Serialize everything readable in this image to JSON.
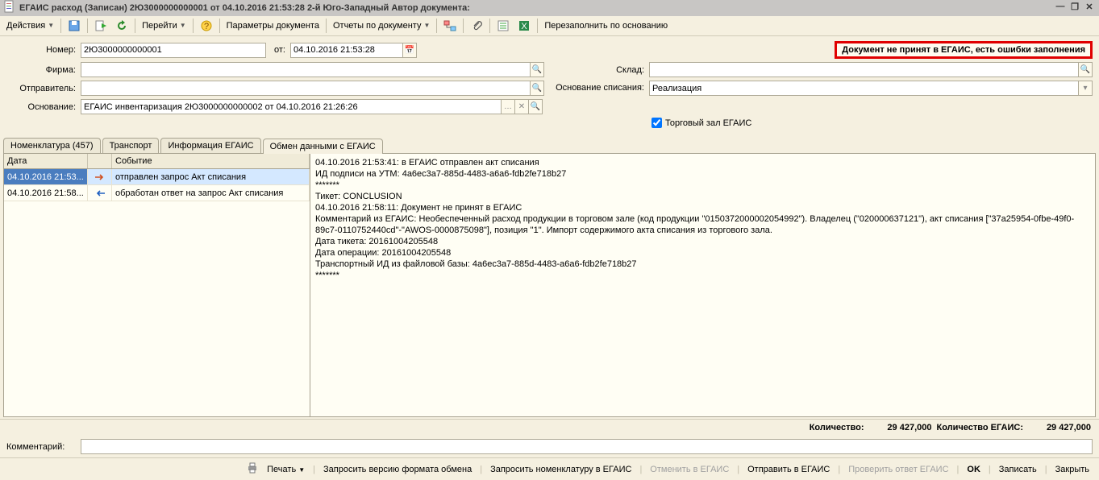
{
  "title": "ЕГАИС расход (Записан)  2Ю3000000000001 от 04.10.2016 21:53:28 2-й Юго-Западный Автор документа:",
  "toolbar": {
    "actions": "Действия",
    "go": "Перейти",
    "doc_params": "Параметры документа",
    "doc_reports": "Отчеты по документу",
    "refill": "Перезаполнить по основанию"
  },
  "form": {
    "number_label": "Номер:",
    "number": "2Ю3000000000001",
    "from_label": "от:",
    "from": "04.10.2016 21:53:28",
    "firm_label": "Фирма:",
    "firm": "",
    "sender_label": "Отправитель:",
    "sender": "",
    "basis_label": "Основание:",
    "basis": "ЕГАИС инвентаризация 2Ю3000000000002 от 04.10.2016 21:26:26",
    "warehouse_label": "Склад:",
    "warehouse": "",
    "writeoff_basis_label": "Основание списания:",
    "writeoff_basis": "Реализация",
    "trade_hall_label": "Торговый зал ЕГАИС",
    "error_banner": "Документ не принят в ЕГАИС, есть ошибки заполнения"
  },
  "tabs": {
    "nomenclature": "Номенклатура (457)",
    "transport": "Транспорт",
    "egais_info": "Информация ЕГАИС",
    "exchange": "Обмен данными с ЕГАИС"
  },
  "grid": {
    "col_date": "Дата",
    "col_event": "Событие",
    "rows": [
      {
        "date": "04.10.2016 21:53...",
        "event": "отправлен запрос Акт списания"
      },
      {
        "date": "04.10.2016 21:58...",
        "event": "обработан ответ на запрос Акт списания"
      }
    ]
  },
  "log": "04.10.2016 21:53:41: в ЕГАИС отправлен акт списания\nИД подписи на УТМ: 4a6ec3a7-885d-4483-a6a6-fdb2fe718b27\n*******\nТикет: CONCLUSION\n04.10.2016 21:58:11: Документ не принят в ЕГАИС\nКомментарий из ЕГАИС: Необеспеченный расход продукции в торговом зале (код продукции \"0150372000002054992\"). Владелец (\"020000637121\"), акт списания [\"37a25954-0fbe-49f0-89c7-0110752440cd\"-\"AWOS-0000875098\"], позиция \"1\". Импорт содержимого акта списания из торгового зала.\nДата тикета: 20161004205548\nДата операции: 20161004205548\nТранспортный ИД из файловой базы: 4a6ec3a7-885d-4483-a6a6-fdb2fe718b27\n*******",
  "stats": {
    "qty_label": "Количество:",
    "qty": "29 427,000",
    "qty_egais_label": "Количество ЕГАИС:",
    "qty_egais": "29 427,000"
  },
  "comment_label": "Комментарий:",
  "actions": {
    "print": "Печать",
    "request_version": "Запросить версию формата обмена",
    "request_nomenclature": "Запросить номенклатуру в ЕГАИС",
    "cancel": "Отменить в ЕГАИС",
    "send": "Отправить в ЕГАИС",
    "check_answer": "Проверить ответ ЕГАИС",
    "ok": "OK",
    "save": "Записать",
    "close": "Закрыть"
  }
}
